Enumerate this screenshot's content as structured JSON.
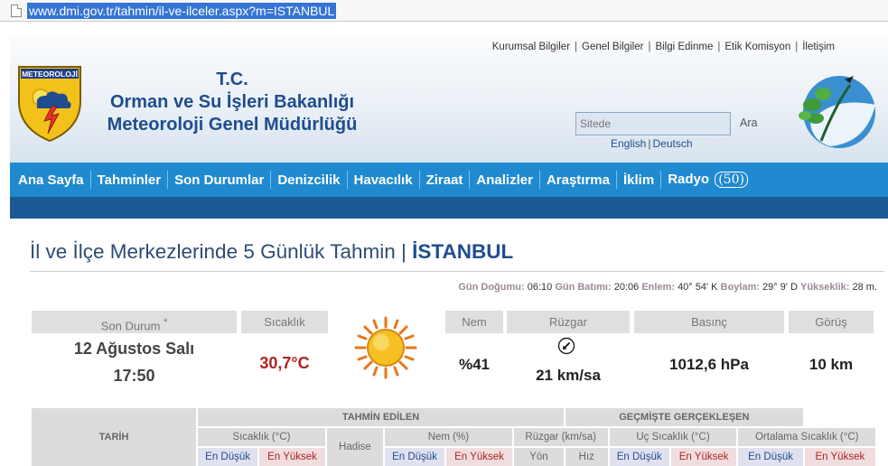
{
  "browser": {
    "url": "www.dmi.gov.tr/tahmin/il-ve-ilceler.aspx?m=ISTANBUL"
  },
  "header": {
    "top_links": [
      "Kurumsal Bilgiler",
      "Genel Bilgiler",
      "Bilgi Edinme",
      "Etik Komisyon",
      "İletişim"
    ],
    "logo_text": "METEOROLOJİ",
    "brand_line1": "T.C.",
    "brand_line2": "Orman ve Su İşleri Bakanlığı",
    "brand_line3": "Meteoroloji Genel Müdürlüğü",
    "search_placeholder": "Sitede",
    "search_button": "Ara",
    "lang_en": "English",
    "lang_de": "Deutsch"
  },
  "nav": {
    "items": [
      "Ana Sayfa",
      "Tahminler",
      "Son Durumlar",
      "Denizcilik",
      "Havacılık",
      "Ziraat",
      "Analizler",
      "Araştırma",
      "İklim",
      "Radyo"
    ],
    "badge": "(50)"
  },
  "page": {
    "title_prefix": "İl ve İlçe Merkezlerinde 5 Günlük Tahmin | ",
    "city": "İSTANBUL",
    "sun": {
      "sunrise_label": "Gün Doğumu:",
      "sunrise": "06:10",
      "sunset_label": "Gün Batımı:",
      "sunset": "20:06",
      "lat_label": "Enlem:",
      "lat": "40° 54' K",
      "lon_label": "Boylam:",
      "lon": "29° 9' D",
      "alt_label": "Yükseklik:",
      "alt": "28 m."
    }
  },
  "current": {
    "son_durum_label": "Son Durum",
    "son_durum_mark": "*",
    "date": "12 Ağustos Salı",
    "time": "17:50",
    "temp_label": "Sıcaklık",
    "temp": "30,7°C",
    "humidity_label": "Nem",
    "humidity": "%41",
    "wind_label": "Rüzgar",
    "wind": "21 km/sa",
    "pressure_label": "Basınç",
    "pressure": "1012,6 hPa",
    "visibility_label": "Görüş",
    "visibility": "10 km"
  },
  "forecast_table": {
    "tarih": "TARİH",
    "tahmin_edilen": "TAHMİN EDİLEN",
    "gecmiste": "GEÇMİŞTE GERÇEKLEŞEN",
    "sicaklik": "Sıcaklık (°C)",
    "hadise": "Hadise",
    "nem": "Nem (%)",
    "ruzgar": "Rüzgar (km/sa)",
    "uc_sicaklik": "Uç Sıcaklık (°C)",
    "ort_sicaklik": "Ortalama Sıcaklık (°C)",
    "en_dusuk": "En Düşük",
    "en_yuksek": "En Yüksek",
    "yon": "Yön",
    "hiz": "Hız"
  },
  "colors": {
    "nav_blue": "#1f8ad0",
    "subnav_blue": "#1b5a94",
    "brand_blue": "#1f4d8f",
    "temp_red": "#b22222"
  }
}
